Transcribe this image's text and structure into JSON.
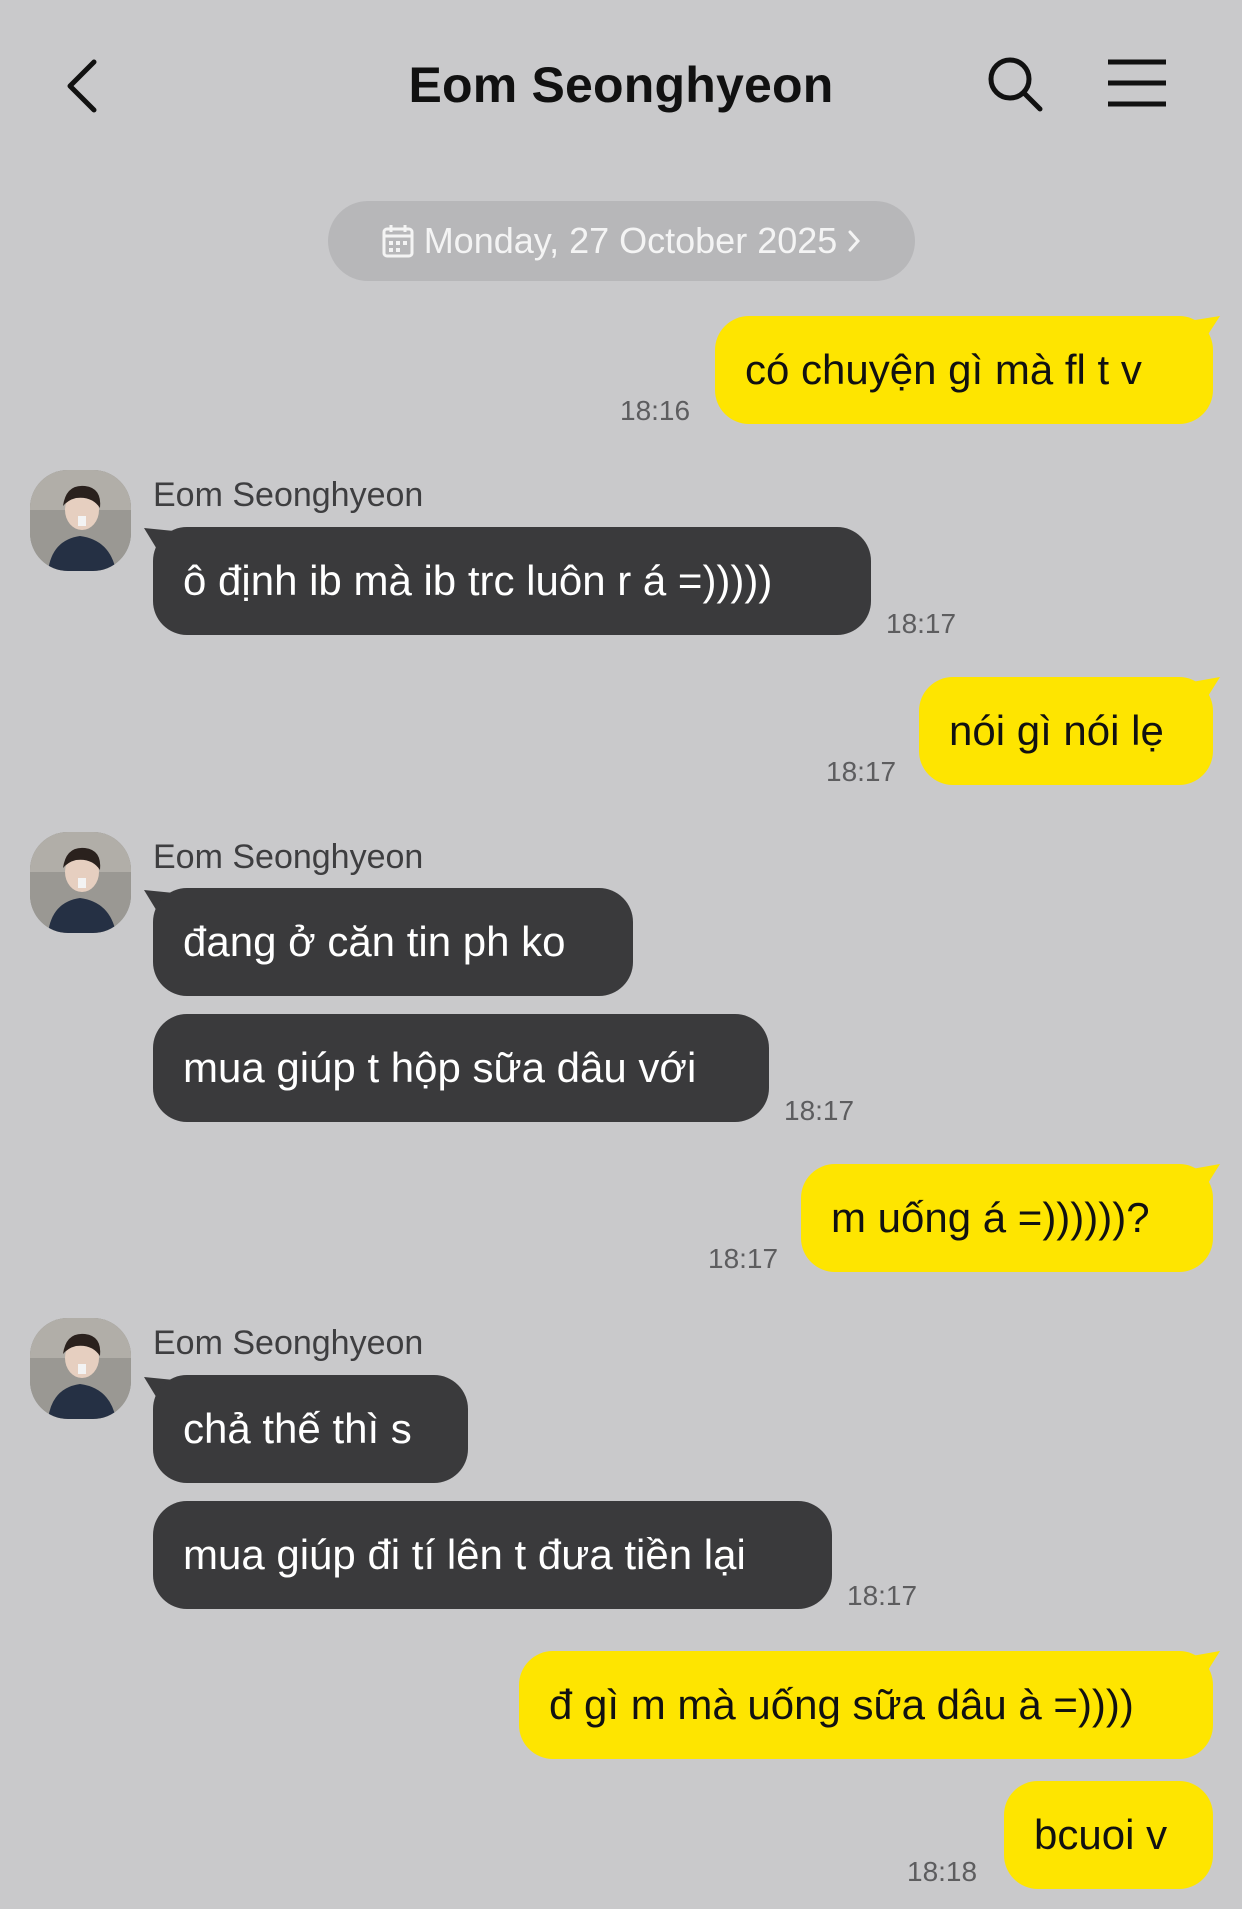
{
  "header": {
    "title": "Eom Seonghyeon"
  },
  "date_divider": "Monday, 27 October 2025",
  "colors": {
    "background": "#c9c9cb",
    "my_bubble": "#fee500",
    "their_bubble": "#3a3a3c",
    "date_pill": "#b7b7b9"
  },
  "messages": [
    {
      "side": "me",
      "text": "có chuyện gì mà fl t v",
      "time": "18:16"
    },
    {
      "side": "them",
      "sender": "Eom Seonghyeon",
      "text": "ô định ib mà ib trc luôn r á =)))))",
      "time": "18:17"
    },
    {
      "side": "me",
      "text": "nói gì nói lẹ",
      "time": "18:17"
    },
    {
      "side": "them",
      "sender": "Eom Seonghyeon",
      "text": "đang ở căn tin ph ko"
    },
    {
      "side": "them",
      "text": "mua giúp t hộp sữa dâu với",
      "time": "18:17"
    },
    {
      "side": "me",
      "text": "m uống á =))))))?",
      "time": "18:17"
    },
    {
      "side": "them",
      "sender": "Eom Seonghyeon",
      "text": "chả thế thì s"
    },
    {
      "side": "them",
      "text": "mua giúp đi tí lên t đưa tiền lại",
      "time": "18:17"
    },
    {
      "side": "me",
      "text": "đ gì m mà uống sữa dâu à =))))"
    },
    {
      "side": "me",
      "text": "bcuoi v",
      "time": "18:18"
    }
  ]
}
